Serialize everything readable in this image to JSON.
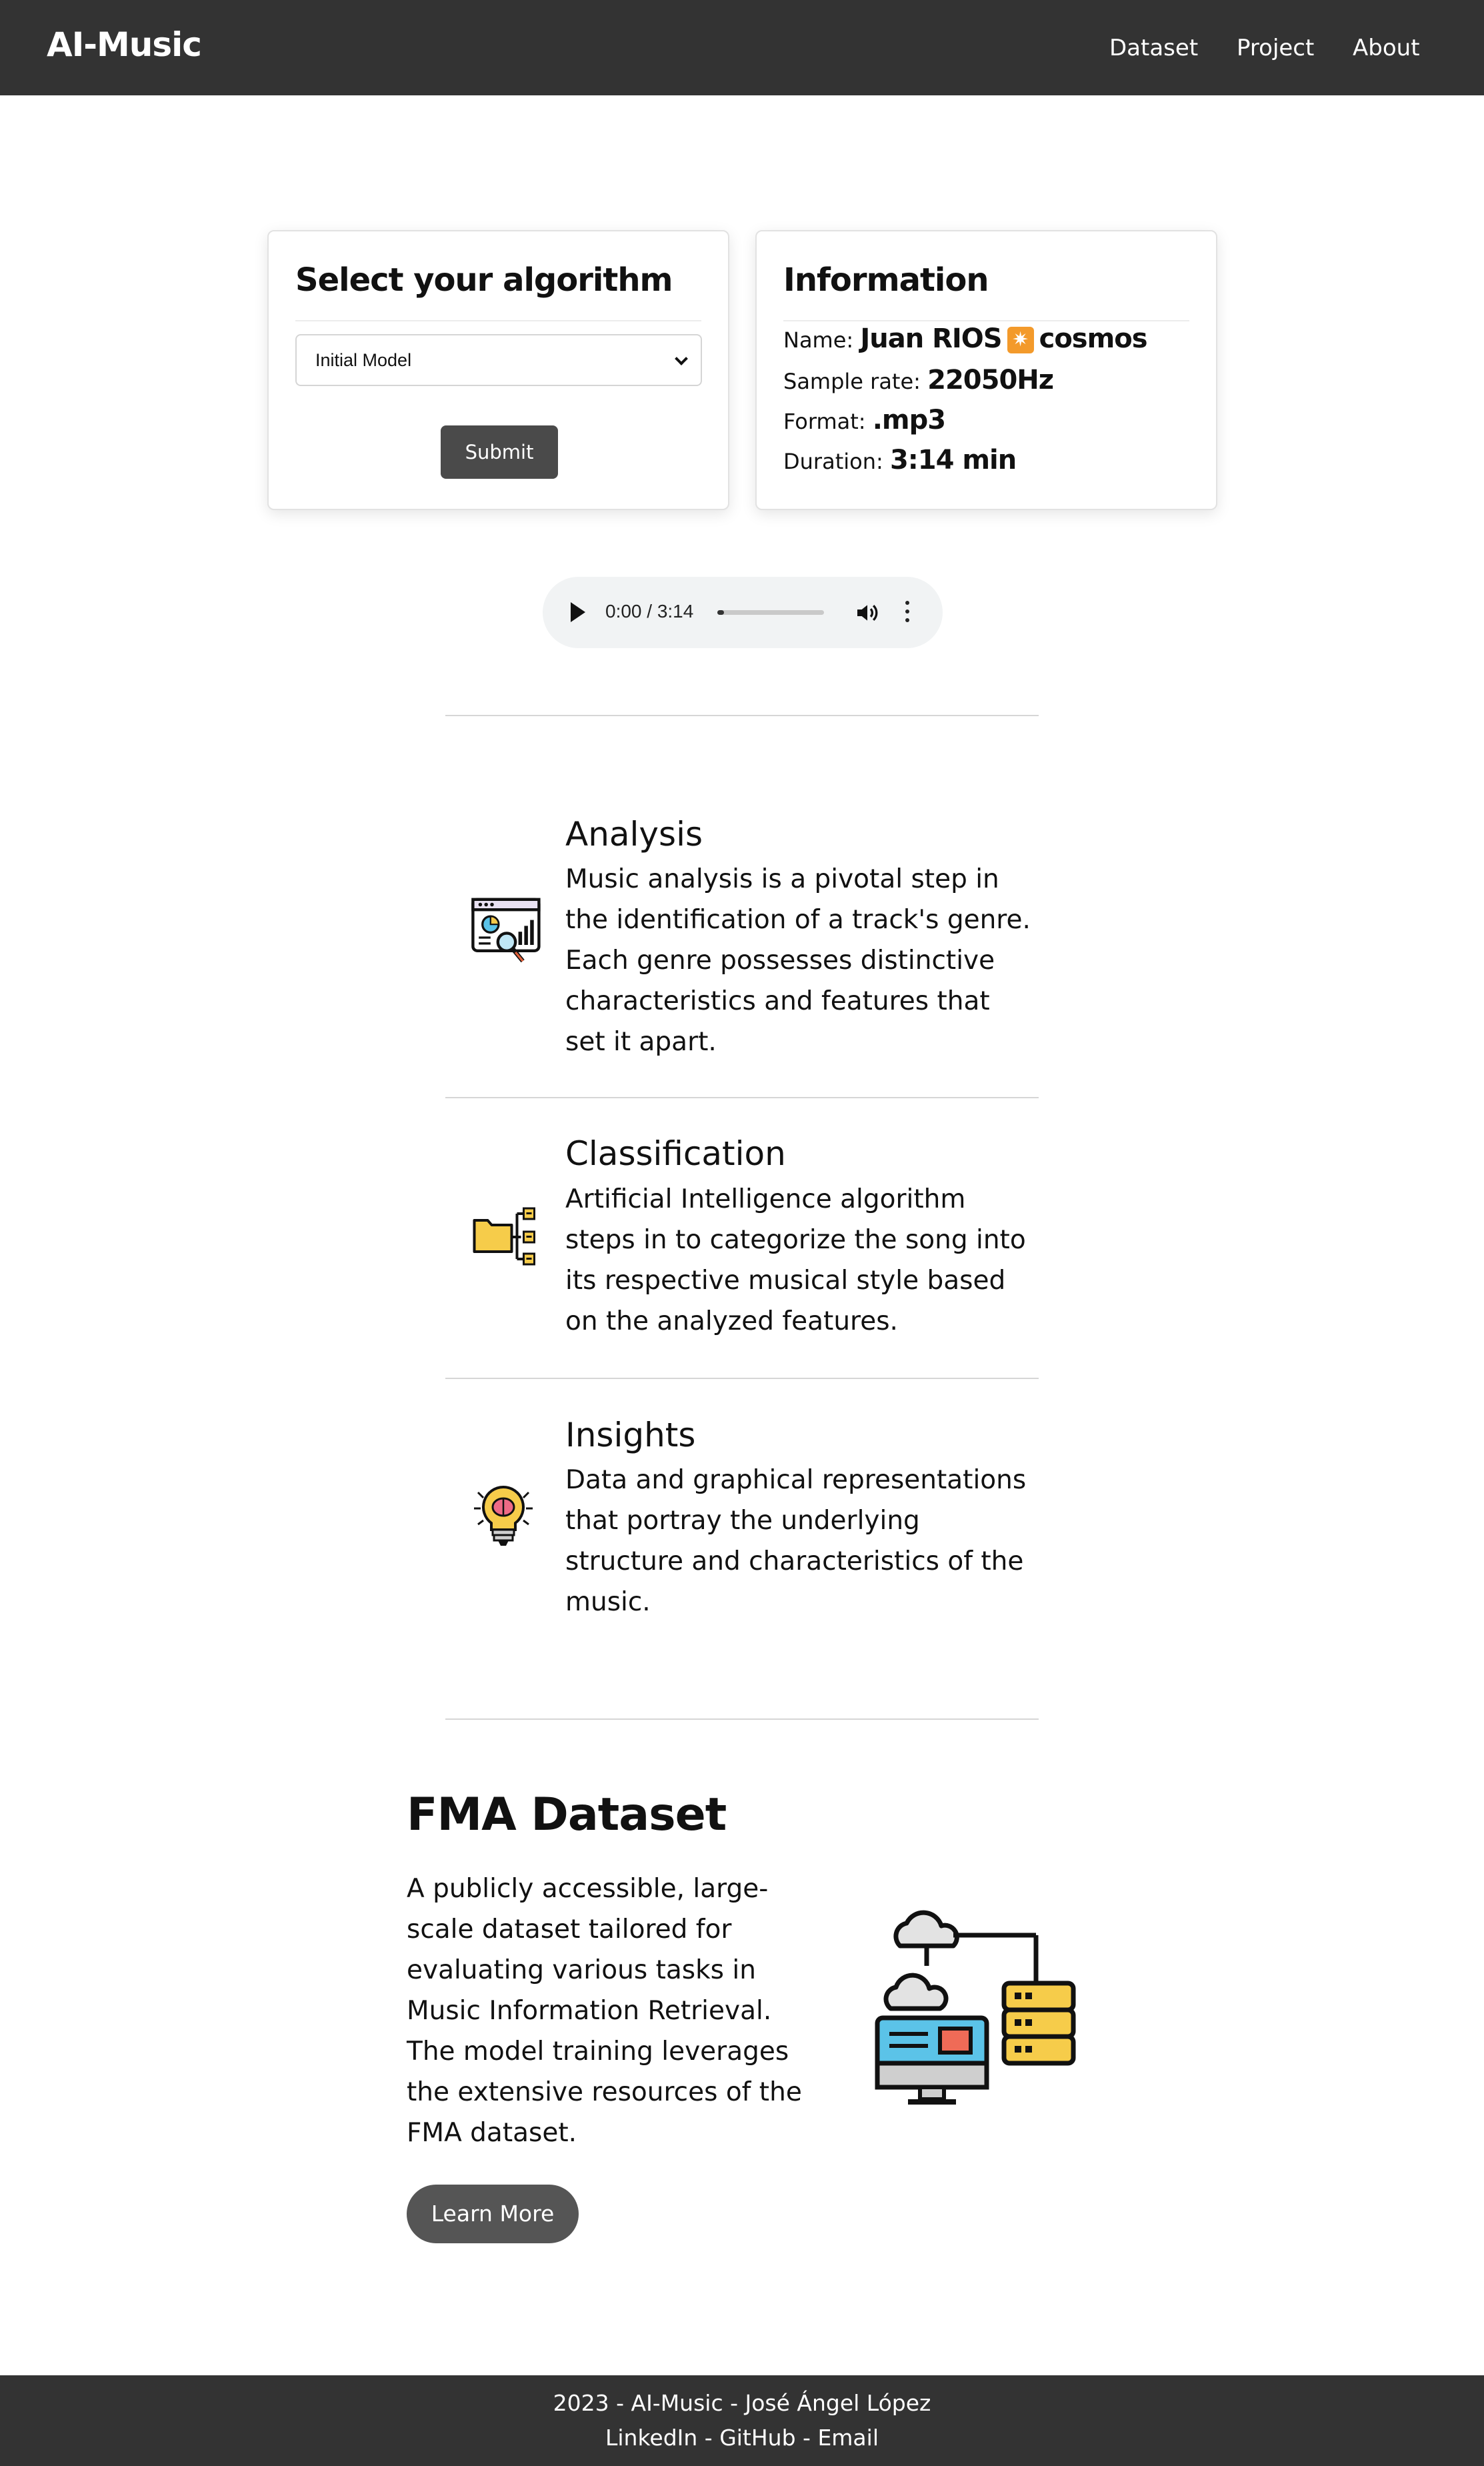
{
  "navbar": {
    "brand": "AI-Music",
    "links": [
      "Dataset",
      "Project",
      "About"
    ]
  },
  "algorithm_card": {
    "title": "Select your algorithm",
    "select_value": "Initial Model",
    "submit_label": "Submit"
  },
  "info_card": {
    "title": "Information",
    "name_label": "Name:",
    "name_value": "Juan RIOS",
    "name_suffix": "cosmos",
    "rate_label": "Sample rate:",
    "rate_value": "22050Hz",
    "format_label": "Format:",
    "format_value": ".mp3",
    "duration_label": "Duration:",
    "duration_value": "3:14 min"
  },
  "audio_player": {
    "time": "0:00 / 3:14",
    "progress": 0
  },
  "features": [
    {
      "icon": "analysis-dashboard-icon",
      "title": "Analysis",
      "description": "Music analysis is a pivotal step in the identification of a track's genre. Each genre possesses distinctive characteristics and features that set it apart."
    },
    {
      "icon": "folder-hierarchy-icon",
      "title": "Classification",
      "description": "Artificial Intelligence algorithm steps in to categorize the song into its respective musical style based on the analyzed features."
    },
    {
      "icon": "lightbulb-brain-icon",
      "title": "Insights",
      "description": "Data and graphical representations that portray the underlying structure and characteristics of the music."
    }
  ],
  "dataset": {
    "title": "FMA Dataset",
    "description": "A publicly accessible, large-scale dataset tailored for evaluating various tasks in Music Information Retrieval. The model training leverages the extensive resources of the FMA dataset.",
    "button_label": "Learn More",
    "icon": "cloud-server-computer-icon"
  },
  "footer": {
    "line1": "2023 - AI-Music - José Ángel López",
    "links": [
      "LinkedIn",
      "GitHub",
      "Email"
    ],
    "separator": " - "
  },
  "colors": {
    "navbar_bg": "#333333",
    "button_bg": "#4a4a4a",
    "accent_star": "#f39a2b"
  }
}
